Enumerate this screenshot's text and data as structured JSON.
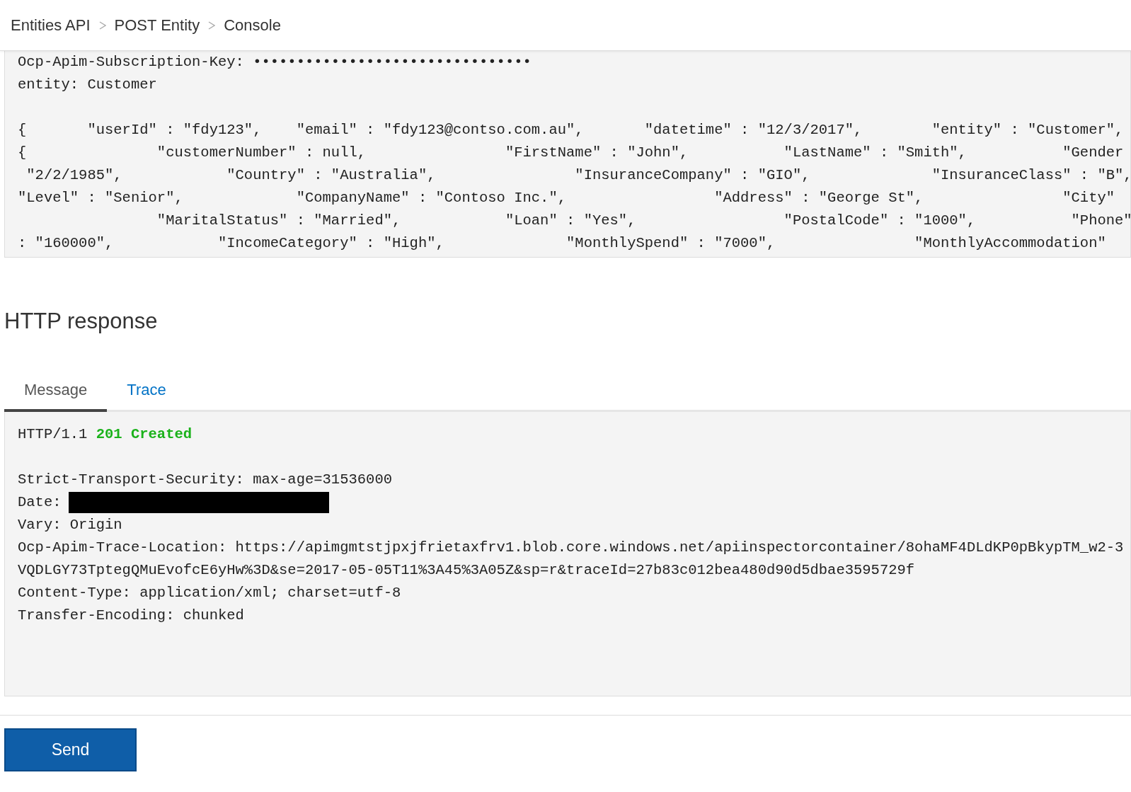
{
  "breadcrumb": [
    "Entities API",
    "POST Entity",
    "Console"
  ],
  "request": {
    "headers": [
      "Ocp-Apim-Subscription-Key: ••••••••••••••••••••••••••••••••",
      "entity: Customer"
    ],
    "body": [
      "{       \"userId\" : \"fdy123\",    \"email\" : \"fdy123@contso.com.au\",       \"datetime\" : \"12/3/2017\",        \"entity\" : \"Customer\",",
      "{               \"customerNumber\" : null,                \"FirstName\" : \"John\",           \"LastName\" : \"Smith\",           \"Gender",
      " \"2/2/1985\",            \"Country\" : \"Australia\",                \"InsuranceCompany\" : \"GIO\",              \"InsuranceClass\" : \"B\",",
      "\"Level\" : \"Senior\",             \"CompanyName\" : \"Contoso Inc.\",                 \"Address\" : \"George St\",                \"City\"",
      "                \"MaritalStatus\" : \"Married\",            \"Loan\" : \"Yes\",                 \"PostalCode\" : \"1000\",           \"Phone\"",
      ": \"160000\",            \"IncomeCategory\" : \"High\",              \"MonthlySpend\" : \"7000\",                \"MonthlyAccommodation\""
    ]
  },
  "response_heading": "HTTP response",
  "tabs": [
    {
      "label": "Message",
      "selected": true
    },
    {
      "label": "Trace",
      "selected": false
    }
  ],
  "response": {
    "protocol": "HTTP/1.1",
    "status": "201 Created",
    "lines": [
      {
        "kind": "blank"
      },
      {
        "kind": "text",
        "text": "Strict-Transport-Security: max-age=31536000"
      },
      {
        "kind": "redacted",
        "text": "Date:"
      },
      {
        "kind": "text",
        "text": "Vary: Origin"
      },
      {
        "kind": "text",
        "text": "Ocp-Apim-Trace-Location: https://apimgmtstjpxjfrietaxfrv1.blob.core.windows.net/apiinspectorcontainer/8ohaMF4DLdKP0pBkypTM_w2-3"
      },
      {
        "kind": "text",
        "text": "VQDLGY73TptegQMuEvofcE6yHw%3D&se=2017-05-05T11%3A45%3A05Z&sp=r&traceId=27b83c012bea480d90d5dbae3595729f"
      },
      {
        "kind": "text",
        "text": "Content-Type: application/xml; charset=utf-8"
      },
      {
        "kind": "text",
        "text": "Transfer-Encoding: chunked"
      }
    ]
  },
  "send_button": "Send"
}
